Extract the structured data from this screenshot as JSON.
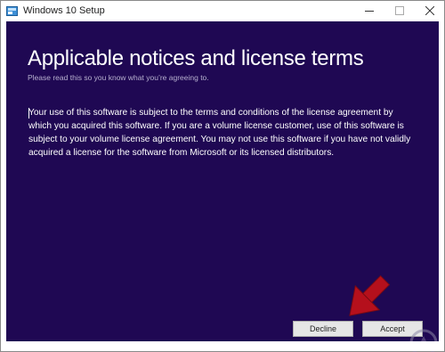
{
  "window": {
    "title": "Windows 10 Setup"
  },
  "titlebar_controls": {
    "minimize_icon": "minimize-icon",
    "maximize_icon": "maximize-icon",
    "close_icon": "close-icon"
  },
  "page": {
    "heading": "Applicable notices and license terms",
    "subheading": "Please read this so you know what you’re agreeing to.",
    "license_text": "Your use of this software is subject to the terms and conditions of the license agreement by which you acquired this software.  If you are a volume license customer, use of this software is subject to your volume license agreement.  You may not use this software if you have not validly acquired a license for the software from Microsoft or its licensed distributors."
  },
  "buttons": {
    "decline_label": "Decline",
    "accept_label": "Accept"
  },
  "colors": {
    "background": "#1f0853",
    "text": "#ffffff",
    "arrow": "#b5101c"
  }
}
